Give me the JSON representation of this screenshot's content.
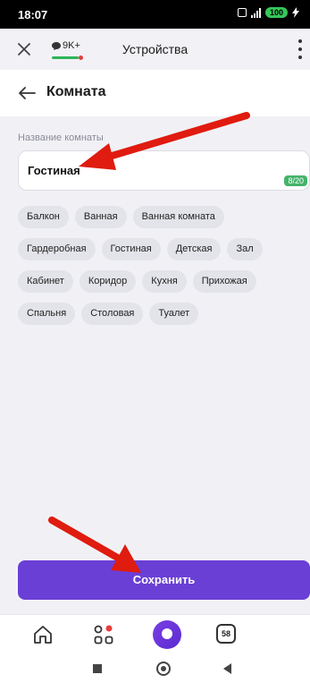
{
  "status_bar": {
    "time": "18:07",
    "battery": "100"
  },
  "toolbar": {
    "badge_count": "9K+",
    "title": "Устройства"
  },
  "header": {
    "title": "Комната"
  },
  "form": {
    "label": "Название комнаты",
    "value": "Гостиная",
    "counter": "8/20"
  },
  "chips": [
    [
      "Балкон",
      "Ванная",
      "Ванная комната"
    ],
    [
      "Гардеробная",
      "Гостиная",
      "Детская",
      "Зал"
    ],
    [
      "Кабинет",
      "Коридор",
      "Кухня",
      "Прихожая"
    ],
    [
      "Спальня",
      "Столовая",
      "Туалет"
    ]
  ],
  "save_button": {
    "label": "Сохранить"
  },
  "bottom_nav": {
    "tab_count": "58"
  },
  "colors": {
    "accent": "#6a3fd6",
    "arrow": "#e01b10",
    "counter": "#45b36b"
  },
  "icons": [
    "close-icon",
    "chat-icon",
    "more-icon",
    "back-arrow-icon",
    "home-icon",
    "devices-icon",
    "alice-icon",
    "tabs-icon"
  ]
}
